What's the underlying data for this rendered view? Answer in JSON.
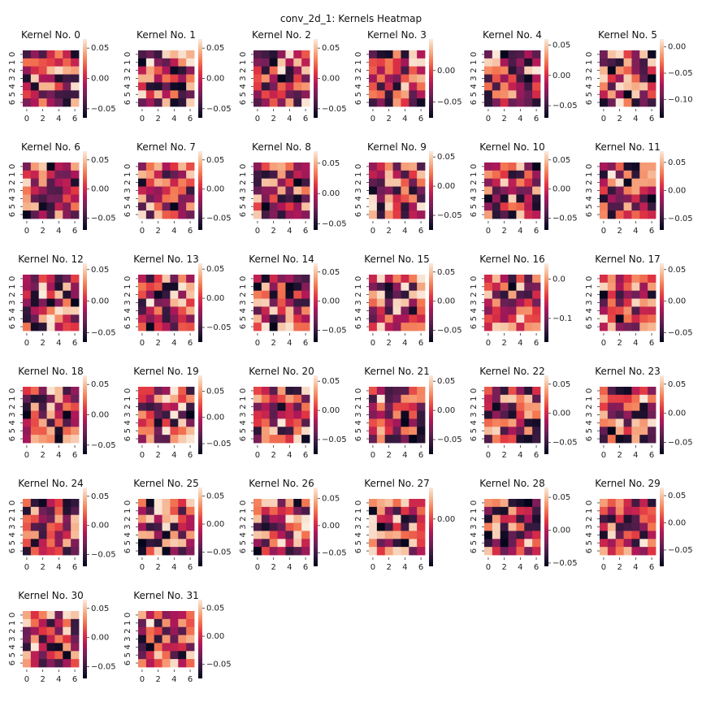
{
  "figure_title": "conv_2d_1: Kernels Heatmap",
  "chart_data": {
    "type": "heatmap",
    "title": "conv_2d_1: Kernels Heatmap",
    "grid_size": 7,
    "x_ticks": [
      "0",
      "2",
      "4",
      "6"
    ],
    "y_ticks": [
      "0",
      "1",
      "2",
      "3",
      "4",
      "5",
      "6"
    ],
    "colormap": "rocket",
    "colormap_stops": [
      "#03051a",
      "#35193e",
      "#701f57",
      "#ad1759",
      "#e13342",
      "#f37651",
      "#f6b48f",
      "#faebdd"
    ],
    "layout": {
      "columns": 6,
      "rows": 6
    },
    "kernels": [
      {
        "title": "Kernel No. 0",
        "vmin": -0.065,
        "vmax": 0.065,
        "cbar_ticks": [
          0.05,
          0.0,
          -0.05
        ],
        "cbar_labels": [
          "0.05",
          "0.00",
          "−0.05"
        ]
      },
      {
        "title": "Kernel No. 1",
        "vmin": -0.065,
        "vmax": 0.065,
        "cbar_ticks": [
          0.05,
          0.0,
          -0.05
        ],
        "cbar_labels": [
          "0.05",
          "0.00",
          "−0.05"
        ]
      },
      {
        "title": "Kernel No. 2",
        "vmin": -0.065,
        "vmax": 0.065,
        "cbar_ticks": [
          0.05,
          0.0,
          -0.05
        ],
        "cbar_labels": [
          "0.05",
          "0.00",
          "−0.05"
        ]
      },
      {
        "title": "Kernel No. 3",
        "vmin": -0.075,
        "vmax": 0.05,
        "cbar_ticks": [
          0.0,
          -0.05
        ],
        "cbar_labels": [
          "0.00",
          "−0.05"
        ]
      },
      {
        "title": "Kernel No. 4",
        "vmin": -0.07,
        "vmax": 0.06,
        "cbar_ticks": [
          0.05,
          0.0,
          -0.05
        ],
        "cbar_labels": [
          "0.05",
          "0.00",
          "−0.05"
        ]
      },
      {
        "title": "Kernel No. 5",
        "vmin": -0.135,
        "vmax": 0.015,
        "cbar_ticks": [
          0.0,
          -0.05,
          -0.1
        ],
        "cbar_labels": [
          "0.00",
          "−0.05",
          "−0.10"
        ]
      },
      {
        "title": "Kernel No. 6",
        "vmin": -0.07,
        "vmax": 0.065,
        "cbar_ticks": [
          0.05,
          0.0,
          -0.05
        ],
        "cbar_labels": [
          "0.05",
          "0.00",
          "−0.05"
        ]
      },
      {
        "title": "Kernel No. 7",
        "vmin": -0.07,
        "vmax": 0.065,
        "cbar_ticks": [
          0.05,
          0.0,
          -0.05
        ],
        "cbar_labels": [
          "0.05",
          "0.00",
          "−0.05"
        ]
      },
      {
        "title": "Kernel No. 8",
        "vmin": -0.06,
        "vmax": 0.07,
        "cbar_ticks": [
          0.05,
          0.0,
          -0.05
        ],
        "cbar_labels": [
          "0.05",
          "0.00",
          "−0.05"
        ]
      },
      {
        "title": "Kernel No. 9",
        "vmin": -0.075,
        "vmax": 0.06,
        "cbar_ticks": [
          0.05,
          0.0,
          -0.05
        ],
        "cbar_labels": [
          "0.05",
          "0.00",
          "−0.05"
        ]
      },
      {
        "title": "Kernel No. 10",
        "vmin": -0.07,
        "vmax": 0.065,
        "cbar_ticks": [
          0.05,
          0.0,
          -0.05
        ],
        "cbar_labels": [
          "0.05",
          "0.00",
          "−0.05"
        ]
      },
      {
        "title": "Kernel No. 11",
        "vmin": -0.07,
        "vmax": 0.07,
        "cbar_ticks": [
          0.05,
          0.0,
          -0.05
        ],
        "cbar_labels": [
          "0.05",
          "0.00",
          "−0.05"
        ]
      },
      {
        "title": "Kernel No. 12",
        "vmin": -0.065,
        "vmax": 0.06,
        "cbar_ticks": [
          0.05,
          0.0,
          -0.05
        ],
        "cbar_labels": [
          "0.05",
          "0.00",
          "−0.05"
        ]
      },
      {
        "title": "Kernel No. 13",
        "vmin": -0.075,
        "vmax": 0.06,
        "cbar_ticks": [
          0.05,
          0.0,
          -0.05
        ],
        "cbar_labels": [
          "0.05",
          "0.00",
          "−0.05"
        ]
      },
      {
        "title": "Kernel No. 14",
        "vmin": -0.07,
        "vmax": 0.065,
        "cbar_ticks": [
          0.05,
          0.0,
          -0.05
        ],
        "cbar_labels": [
          "0.05",
          "0.00",
          "−0.05"
        ]
      },
      {
        "title": "Kernel No. 15",
        "vmin": -0.07,
        "vmax": 0.065,
        "cbar_ticks": [
          0.05,
          0.0,
          -0.05
        ],
        "cbar_labels": [
          "0.05",
          "0.00",
          "−0.05"
        ]
      },
      {
        "title": "Kernel No. 16",
        "vmin": -0.16,
        "vmax": 0.04,
        "cbar_ticks": [
          0.0,
          -0.1
        ],
        "cbar_labels": [
          "0.0",
          "−0.1"
        ]
      },
      {
        "title": "Kernel No. 17",
        "vmin": -0.065,
        "vmax": 0.06,
        "cbar_ticks": [
          0.05,
          0.0,
          -0.05
        ],
        "cbar_labels": [
          "0.05",
          "0.00",
          "−0.05"
        ]
      },
      {
        "title": "Kernel No. 18",
        "vmin": -0.065,
        "vmax": 0.065,
        "cbar_ticks": [
          0.05,
          0.0,
          -0.05
        ],
        "cbar_labels": [
          "0.05",
          "0.00",
          "−0.05"
        ]
      },
      {
        "title": "Kernel No. 19",
        "vmin": -0.07,
        "vmax": 0.08,
        "cbar_ticks": [
          0.05,
          0.0,
          -0.05
        ],
        "cbar_labels": [
          "0.05",
          "0.00",
          "−0.05"
        ]
      },
      {
        "title": "Kernel No. 20",
        "vmin": -0.075,
        "vmax": 0.06,
        "cbar_ticks": [
          0.05,
          0.0,
          -0.05
        ],
        "cbar_labels": [
          "0.05",
          "0.00",
          "−0.05"
        ]
      },
      {
        "title": "Kernel No. 21",
        "vmin": -0.075,
        "vmax": 0.06,
        "cbar_ticks": [
          0.05,
          0.0,
          -0.05
        ],
        "cbar_labels": [
          "0.05",
          "0.00",
          "−0.05"
        ]
      },
      {
        "title": "Kernel No. 22",
        "vmin": -0.07,
        "vmax": 0.065,
        "cbar_ticks": [
          0.05,
          0.0,
          -0.05
        ],
        "cbar_labels": [
          "0.05",
          "0.00",
          "−0.05"
        ]
      },
      {
        "title": "Kernel No. 23",
        "vmin": -0.07,
        "vmax": 0.065,
        "cbar_ticks": [
          0.05,
          0.0,
          -0.05
        ],
        "cbar_labels": [
          "0.05",
          "0.00",
          "−0.05"
        ]
      },
      {
        "title": "Kernel No. 24",
        "vmin": -0.07,
        "vmax": 0.065,
        "cbar_ticks": [
          0.05,
          0.0,
          -0.05
        ],
        "cbar_labels": [
          "0.05",
          "0.00",
          "−0.05"
        ]
      },
      {
        "title": "Kernel No. 25",
        "vmin": -0.075,
        "vmax": 0.065,
        "cbar_ticks": [
          0.05,
          0.0,
          -0.05
        ],
        "cbar_labels": [
          "0.05",
          "0.00",
          "−0.05"
        ]
      },
      {
        "title": "Kernel No. 26",
        "vmin": -0.075,
        "vmax": 0.07,
        "cbar_ticks": [
          0.05,
          0.0,
          -0.05
        ],
        "cbar_labels": [
          "0.05",
          "0.00",
          "−0.05"
        ]
      },
      {
        "title": "Kernel No. 27",
        "vmin": -0.09,
        "vmax": 0.06,
        "cbar_ticks": [
          0.0
        ],
        "cbar_labels": [
          "0.00"
        ]
      },
      {
        "title": "Kernel No. 28",
        "vmin": -0.055,
        "vmax": 0.065,
        "cbar_ticks": [
          0.05,
          0.0,
          -0.05
        ],
        "cbar_labels": [
          "0.05",
          "0.00",
          "−0.05"
        ]
      },
      {
        "title": "Kernel No. 29",
        "vmin": -0.08,
        "vmax": 0.065,
        "cbar_ticks": [
          0.05,
          0.0,
          -0.05
        ],
        "cbar_labels": [
          "0.05",
          "0.00",
          "−0.05"
        ]
      },
      {
        "title": "Kernel No. 30",
        "vmin": -0.07,
        "vmax": 0.065,
        "cbar_ticks": [
          0.05,
          0.0,
          -0.05
        ],
        "cbar_labels": [
          "0.05",
          "0.00",
          "−0.05"
        ]
      },
      {
        "title": "Kernel No. 31",
        "vmin": -0.075,
        "vmax": 0.065,
        "cbar_ticks": [
          0.05,
          0.0,
          -0.05
        ],
        "cbar_labels": [
          "0.05",
          "0.00",
          "−0.05"
        ]
      }
    ]
  }
}
